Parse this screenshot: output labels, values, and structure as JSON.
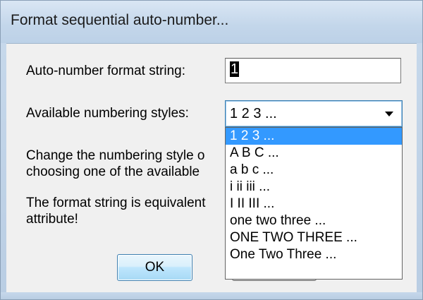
{
  "window": {
    "title": "Format sequential auto-number..."
  },
  "form": {
    "format_label": "Auto-number format string:",
    "format_value": "1",
    "styles_label": "Available numbering styles:",
    "styles_selected": "1 2 3 ..."
  },
  "info": {
    "line1": "Change the numbering style o",
    "line2": "choosing one of the available",
    "line3": "The format string is equivalent",
    "line4": "attribute!"
  },
  "dropdown": {
    "options": [
      "1 2 3 ...",
      "A B C ...",
      "a b c ...",
      "i ii iii ...",
      "I II III ...",
      "one two three ...",
      "ONE TWO THREE ...",
      "One Two Three ..."
    ],
    "highlighted_index": 0
  },
  "buttons": {
    "ok_label": "OK"
  },
  "colors": {
    "highlight": "#3399ff",
    "titlebar": "#c3d6ea",
    "dialog_bg": "#f0f0f0"
  }
}
